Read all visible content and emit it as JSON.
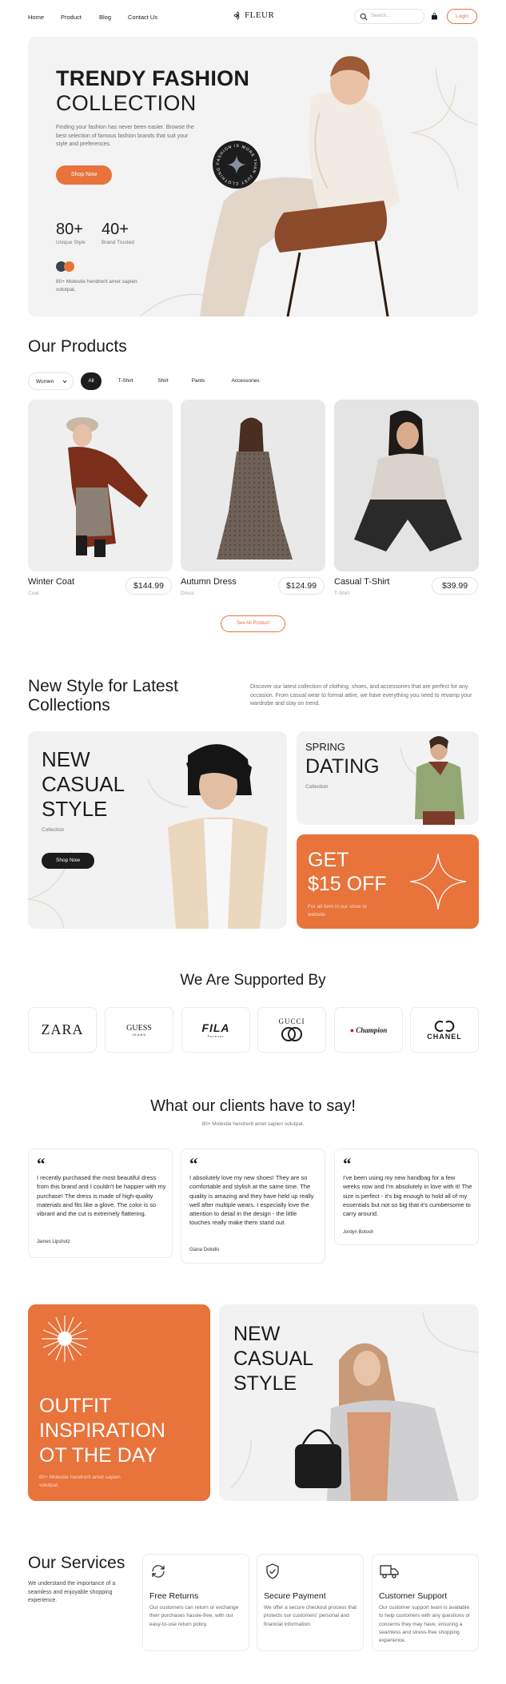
{
  "nav": {
    "links": [
      "Home",
      "Product",
      "Blog",
      "Contact Us"
    ],
    "logo": "FLEUR",
    "search_placeholder": "Search...",
    "login_label": "Login"
  },
  "hero": {
    "title_line1": "TRENDY FASHION",
    "title_line2": "COLLECTION",
    "description": "Finding your fashion has never been easier. Browse the best selection of famous fashion brands that suit your style and preferences.",
    "cta_label": "Shop Now",
    "stats": [
      {
        "value": "80+",
        "label": "Unique Style"
      },
      {
        "value": "40+",
        "label": "Brand Trusted"
      }
    ],
    "swatch_note": "80+ Molestie hendrerit amet sapien volutpat.",
    "badge_text": "FASHION IS MORE THAN JUST CLOTHING",
    "colors": {
      "accent": "#e8733b",
      "swatch_dark": "#3b4250"
    }
  },
  "products": {
    "title": "Our Products",
    "dropdown_value": "Women",
    "filters": [
      "All",
      "T-Shirt",
      "Shirt",
      "Pants",
      "Accessories"
    ],
    "active_filter": "All",
    "items": [
      {
        "name": "Winter Coat",
        "category": "Coat",
        "price": "$144.99"
      },
      {
        "name": "Autumn Dress",
        "category": "Dress",
        "price": "$124.99"
      },
      {
        "name": "Casual T-Shirt",
        "category": "T-Shirt",
        "price": "$39.99"
      }
    ],
    "see_all_label": "See All Product"
  },
  "new_style": {
    "title_line1": "New Style for Latest",
    "title_line2": "Collections",
    "description": "Discover our latest collection of clothing, shoes, and accessories that are perfect for any occasion. From casual wear to formal attire, we have everything you need to revamp your wardrobe and stay on trend.",
    "casual": {
      "line1": "NEW",
      "line2": "CASUAL",
      "line3": "STYLE",
      "sub": "Collection",
      "cta": "Shop Now"
    },
    "spring": {
      "line1": "SPRING",
      "line2": "DATING",
      "sub": "Collection"
    },
    "offer": {
      "line1": "GET",
      "line2": "$15 OFF",
      "note": "For all item in our store or website"
    }
  },
  "supported": {
    "title": "We Are Supported By",
    "brands": [
      "ZARA",
      "GUESS",
      "FILA",
      "GUCCI",
      "Champion",
      "CHANEL"
    ],
    "brand_subs": {
      "guess": "JEANS",
      "fila": "Forever",
      "chanel_sub": "CHANEL"
    }
  },
  "testimonials": {
    "title": "What our clients have to say!",
    "subtitle": "80+ Molestie hendrerit amet sapien volutpat.",
    "items": [
      {
        "text": "I recently purchased the most beautiful dress from this brand and I couldn't be happier with my purchase! The dress is made of high-quality materials and fits like a glove. The color is so vibrant and the cut is extremely flattering.",
        "name": "James Lipshutz"
      },
      {
        "text": "I absolutely love my new shoes! They are so comfortable and stylish at the same time. The quality is amazing and they have held up really well after multiple wears. I especially love the attention to detail in the design - the little touches really make them stand out.",
        "name": "Giana Dokidis"
      },
      {
        "text": "I've been using my new handbag for a few weeks now and I'm absolutely in love with it! The size is perfect - it's big enough to hold all of my essentials but not so big that it's cumbersome to carry around.",
        "name": "Jordyn Botosh"
      }
    ]
  },
  "inspiration": {
    "line1": "OUTFIT",
    "line2": "INSPIRATION",
    "line3": "OT THE DAY",
    "note": "80+ Molestie hendrerit amet sapien volutpat.",
    "casual_line1": "NEW",
    "casual_line2": "CASUAL",
    "casual_line3": "STYLE"
  },
  "services": {
    "title": "Our Services",
    "description": "We understand the importance of a seamless and enjoyable shopping experience.",
    "items": [
      {
        "icon": "refresh-icon",
        "title": "Free Returns",
        "text": "Our customers can return or exchange their purchases hassle-free, with our easy-to-use return policy."
      },
      {
        "icon": "shield-check-icon",
        "title": "Secure Payment",
        "text": "We offer a secure checkout process that protects our customers' personal and financial information."
      },
      {
        "icon": "truck-icon",
        "title": "Customer Support",
        "text": "Our customer support team is available to help customers with any questions or concerns they may have, ensuring a seamless and stress-free shopping experience."
      }
    ]
  }
}
